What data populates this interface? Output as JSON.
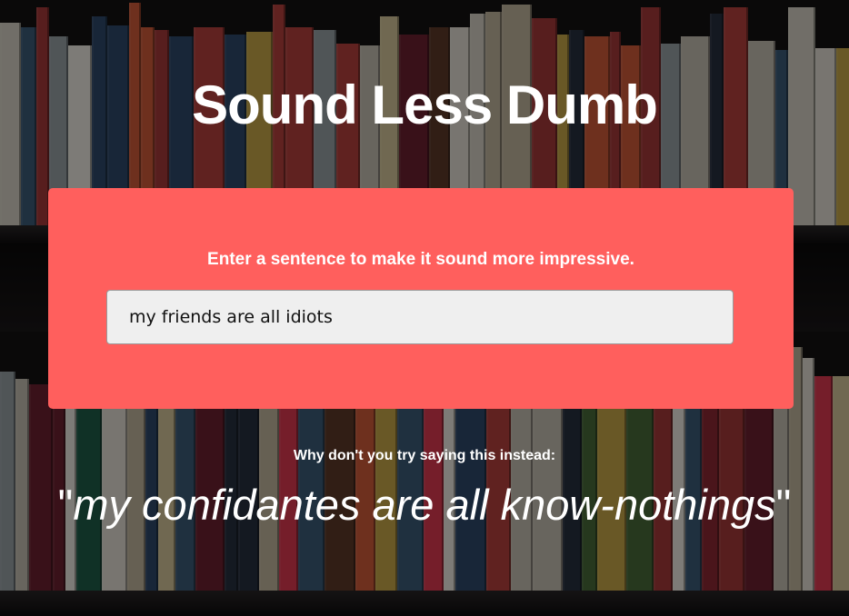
{
  "page": {
    "title": "Sound Less Dumb"
  },
  "form": {
    "prompt": "Enter a sentence to make it sound more impressive.",
    "input_value": "my friends are all idiots"
  },
  "suggestion": {
    "label": "Why don't you try saying this instead:",
    "open_quote": "\"",
    "text": "my confidantes are all know-nothings",
    "close_quote": "\""
  },
  "colors": {
    "card": "#ff5f5d",
    "text": "#ffffff",
    "input_bg": "#efefef"
  },
  "icons": {
    "background": "bookshelf-background-image"
  }
}
